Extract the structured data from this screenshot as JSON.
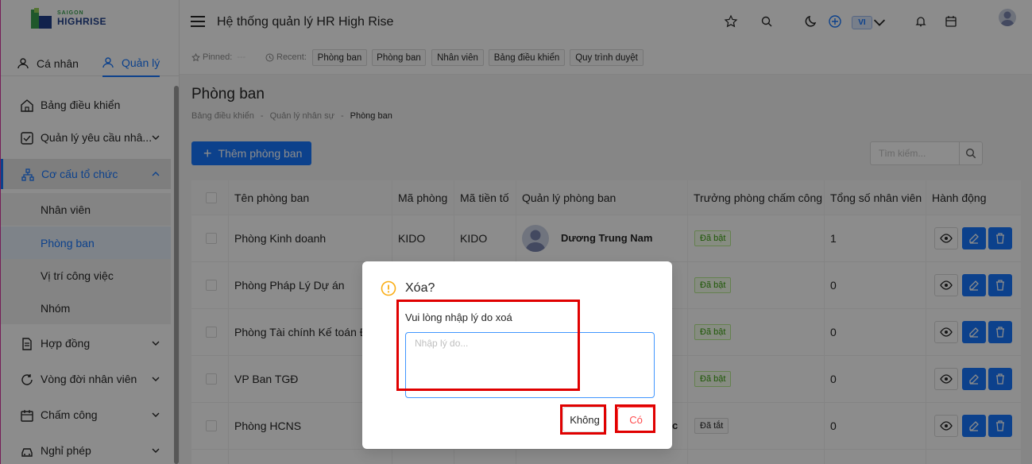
{
  "brand": {
    "line1": "SAIGON",
    "line2": "HIGHRISE"
  },
  "header": {
    "title": "Hệ thống quản lý HR High Rise",
    "lang": "VI"
  },
  "sidebar": {
    "tabs": {
      "personal": "Cá nhân",
      "manage": "Quản lý"
    },
    "items": [
      {
        "label": "Bảng điều khiển"
      },
      {
        "label": "Quản lý yêu cầu nhâ..."
      },
      {
        "label": "Cơ cấu tổ chức"
      },
      {
        "label": "Hợp đồng"
      },
      {
        "label": "Vòng đời nhân viên"
      },
      {
        "label": "Chấm công"
      },
      {
        "label": "Nghỉ phép"
      }
    ],
    "subitems": [
      {
        "label": "Nhân viên"
      },
      {
        "label": "Phòng ban"
      },
      {
        "label": "Vị trí công việc"
      },
      {
        "label": "Nhóm"
      }
    ]
  },
  "recent": {
    "pinned_label": "Pinned:",
    "pinned_value": "---",
    "recent_label": "Recent:",
    "chips": [
      "Phòng ban",
      "Phòng ban",
      "Nhân viên",
      "Bảng điều khiển",
      "Quy trình duyệt"
    ]
  },
  "page": {
    "title": "Phòng ban",
    "breadcrumb": [
      "Bảng điều khiển",
      "Quản lý nhân sự",
      "Phòng ban"
    ],
    "breadcrumb_sep": "-",
    "add_label": "Thêm phòng ban",
    "search_placeholder": "Tìm kiếm..."
  },
  "table": {
    "headers": [
      "Tên phòng ban",
      "Mã phòng",
      "Mã tiền tố",
      "Quản lý phòng ban",
      "Trưởng phòng chấm công",
      "Tổng số nhân viên",
      "Hành động"
    ],
    "rows": [
      {
        "name": "Phòng Kinh doanh",
        "code": "KIDO",
        "prefix": "KIDO",
        "manager": "Dương Trung Nam",
        "status": "Đã bật",
        "total": "1"
      },
      {
        "name": "Phòng Pháp Lý Dự án",
        "code": "",
        "prefix": "",
        "manager": "",
        "status": "Đã bật",
        "total": "0"
      },
      {
        "name": "Phòng Tài chính Kế toán Đầ",
        "code": "",
        "prefix": "",
        "manager": "",
        "status": "Đã bật",
        "total": "0"
      },
      {
        "name": "VP Ban TGĐ",
        "code": "",
        "prefix": "",
        "manager": "",
        "status": "Đã bật",
        "total": "0"
      },
      {
        "name": "Phòng HCNS",
        "code": "",
        "prefix": "",
        "manager": "c",
        "status": "Đã tắt",
        "total": "0"
      }
    ]
  },
  "modal": {
    "title": "Xóa?",
    "label": "Vui lòng nhập lý do xoá",
    "placeholder": "Nhập lý do...",
    "no_label": "Không",
    "yes_label": "Có"
  },
  "colors": {
    "primary": "#1677ff",
    "danger": "#ff4d4f",
    "highlight": "#e00000"
  }
}
